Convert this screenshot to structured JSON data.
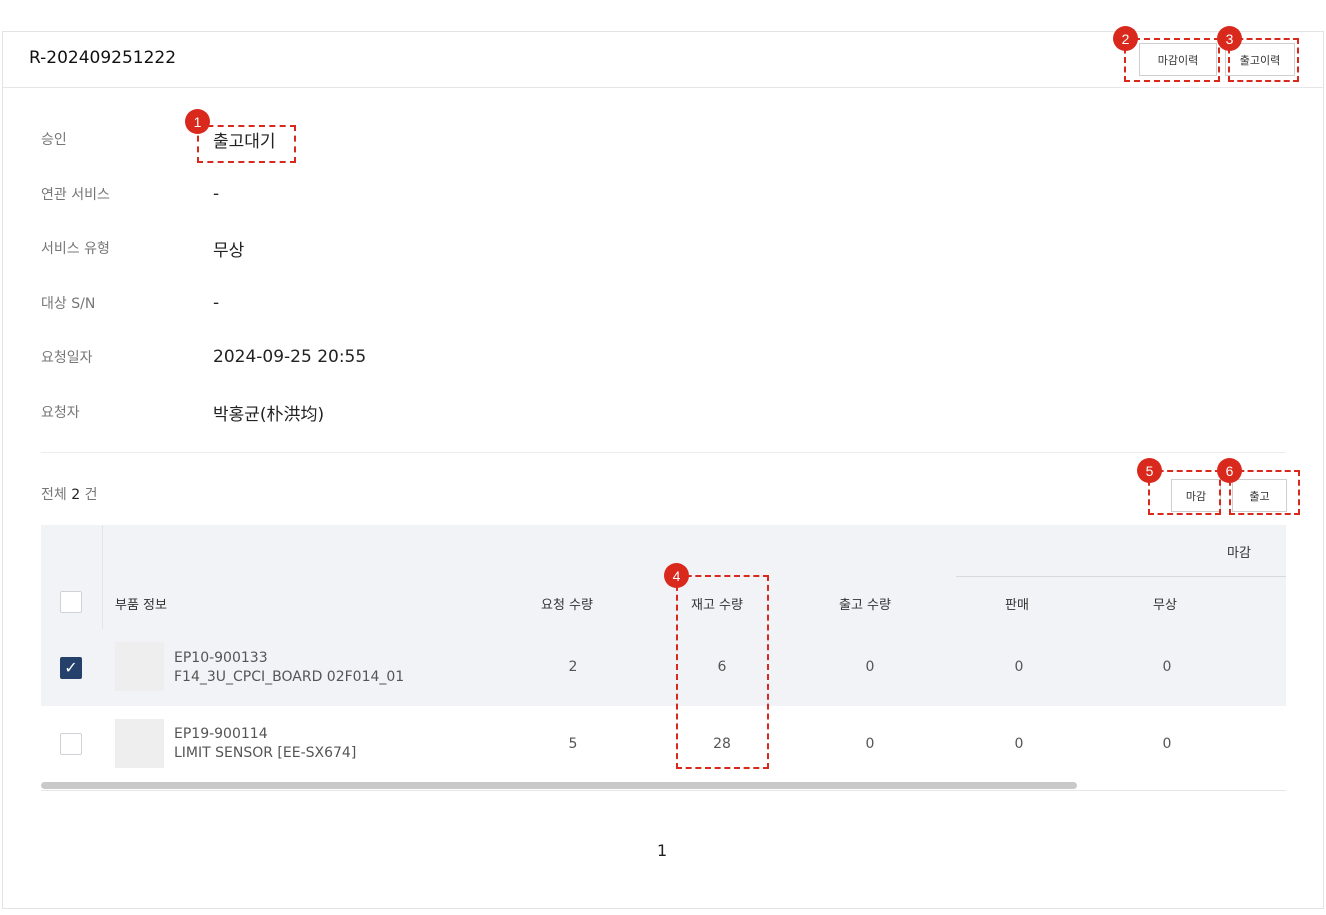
{
  "header": {
    "request_id": "R-202409251222",
    "btn_close_history": "마감이력",
    "btn_release_history": "출고이력"
  },
  "info": [
    {
      "label": "승인",
      "value": "출고대기"
    },
    {
      "label": "연관 서비스",
      "value": "-"
    },
    {
      "label": "서비스 유형",
      "value": "무상"
    },
    {
      "label": "대상 S/N",
      "value": "-"
    },
    {
      "label": "요청일자",
      "value": "2024-09-25 20:55"
    },
    {
      "label": "요청자",
      "value": "박홍균(朴洪均)"
    }
  ],
  "summary": {
    "prefix": "전체",
    "count": "2",
    "suffix": "건"
  },
  "actions": {
    "close": "마감",
    "release": "출고"
  },
  "table": {
    "group_header": "마감",
    "headers": [
      "부품 정보",
      "요청 수량",
      "재고 수량",
      "출고 수량",
      "판매",
      "무상"
    ],
    "rows": [
      {
        "checked": true,
        "code": "EP10-900133",
        "name": "F14_3U_CPCI_BOARD 02F014_01",
        "requested": "2",
        "stock": "6",
        "released": "0",
        "sale": "0",
        "free": "0"
      },
      {
        "checked": false,
        "code": "EP19-900114",
        "name": "LIMIT SENSOR [EE-SX674]",
        "requested": "5",
        "stock": "28",
        "released": "0",
        "sale": "0",
        "free": "0"
      }
    ]
  },
  "pagination": {
    "current": "1"
  },
  "annotations": [
    "1",
    "2",
    "3",
    "4",
    "5",
    "6"
  ],
  "colors": {
    "annotation": "#d9281c",
    "checkbox_checked": "#24406b",
    "header_bg": "#f1f3f6"
  }
}
